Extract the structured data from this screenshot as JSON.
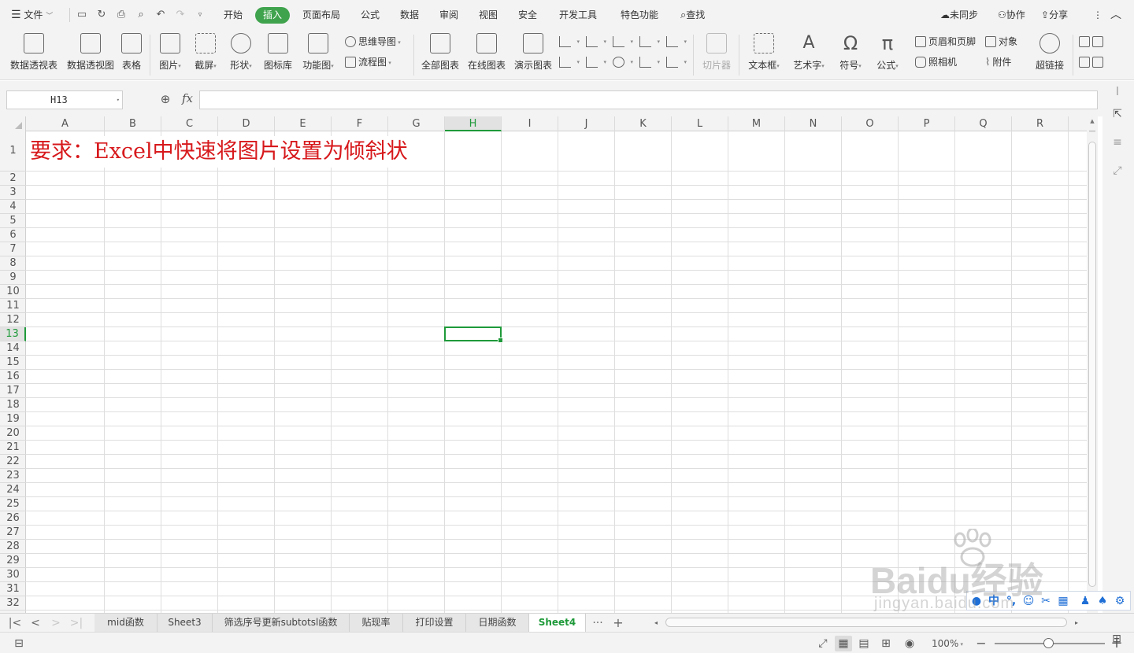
{
  "menubar": {
    "file_label": "文件",
    "tabs": [
      {
        "label": "开始"
      },
      {
        "label": "插入"
      },
      {
        "label": "页面布局"
      },
      {
        "label": "公式"
      },
      {
        "label": "数据"
      },
      {
        "label": "审阅"
      },
      {
        "label": "视图"
      },
      {
        "label": "安全"
      },
      {
        "label": "开发工具"
      },
      {
        "label": "特色功能"
      }
    ],
    "active_tab": "插入",
    "search_label": "查找",
    "sync_label": "未同步",
    "collab_label": "协作",
    "share_label": "分享"
  },
  "ribbon": {
    "pivot_table": "数据透视表",
    "pivot_chart": "数据透视图",
    "table": "表格",
    "picture": "图片",
    "screenshot": "截屏",
    "shapes": "形状",
    "icon_library": "图标库",
    "function_chart": "功能图",
    "mind_map": "思维导图",
    "flow_chart": "流程图",
    "all_charts": "全部图表",
    "online_charts": "在线图表",
    "demo_charts": "演示图表",
    "slicer": "切片器",
    "text_box": "文本框",
    "word_art": "艺术字",
    "symbol": "符号",
    "formula": "公式",
    "header_footer": "页眉和页脚",
    "object": "对象",
    "camera": "照相机",
    "attachment": "附件",
    "hyperlink": "超链接"
  },
  "formula_bar": {
    "name_box": "H13",
    "fx_label": "fx",
    "formula_value": ""
  },
  "grid": {
    "columns": [
      "A",
      "B",
      "C",
      "D",
      "E",
      "F",
      "G",
      "H",
      "I",
      "J",
      "K",
      "L",
      "M",
      "N",
      "O",
      "P",
      "Q",
      "R"
    ],
    "rows": [
      "1",
      "2",
      "3",
      "4",
      "5",
      "6",
      "7",
      "8",
      "9",
      "10",
      "11",
      "12",
      "13",
      "14",
      "15",
      "16",
      "17",
      "18",
      "19",
      "20",
      "21",
      "22",
      "23",
      "24",
      "25",
      "26",
      "27",
      "28",
      "29",
      "30",
      "31",
      "32"
    ],
    "selected_column": "H",
    "selected_row": "13",
    "a1_text": "要求：Excel中快速将图片设置为倾斜状"
  },
  "sheets": {
    "tabs": [
      {
        "label": "mid函数"
      },
      {
        "label": "Sheet3"
      },
      {
        "label": "筛选序号更新subtotsl函数"
      },
      {
        "label": "贴现率"
      },
      {
        "label": "打印设置"
      },
      {
        "label": "日期函数"
      },
      {
        "label": "Sheet4"
      }
    ],
    "active": "Sheet4",
    "more_label": "···",
    "add_label": "+"
  },
  "status": {
    "zoom": "100%"
  },
  "ime": {
    "lang_label": "中"
  },
  "watermark": {
    "main": "Baidu经验",
    "sub": "jingyan.baidu.com"
  },
  "colors": {
    "accent": "#1f9a3a",
    "active_tab_bg": "#3fa34d",
    "title_text": "#d7191c"
  }
}
